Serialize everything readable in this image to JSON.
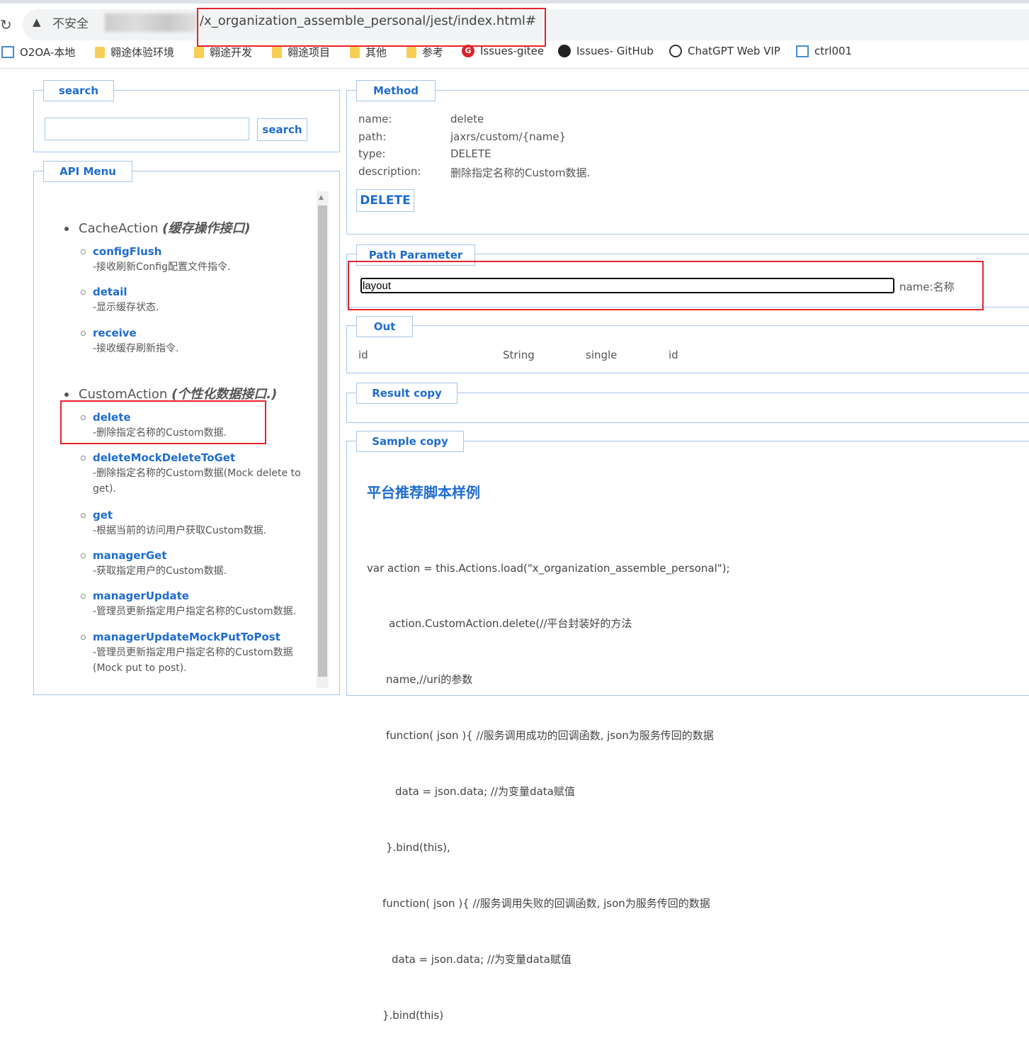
{
  "browser": {
    "security_label": "不安全",
    "url": "/x_organization_assemble_personal/jest/index.html#",
    "bookmarks": [
      {
        "label": "O2OA-本地",
        "icon": "o2oa-icon"
      },
      {
        "label": "翱途体验环境",
        "icon": "folder-icon"
      },
      {
        "label": "翱途开发",
        "icon": "folder-icon"
      },
      {
        "label": "翱途项目",
        "icon": "folder-icon"
      },
      {
        "label": "其他",
        "icon": "folder-icon"
      },
      {
        "label": "参考",
        "icon": "folder-icon"
      },
      {
        "label": "Issues-gitee",
        "icon": "gitee-icon"
      },
      {
        "label": "Issues- GitHub",
        "icon": "github-icon"
      },
      {
        "label": "ChatGPT Web VIP",
        "icon": "openai-icon"
      },
      {
        "label": "ctrl001",
        "icon": "o2oa-icon"
      }
    ]
  },
  "search": {
    "legend": "search",
    "value": "",
    "button": "search"
  },
  "api_menu": {
    "legend": "API Menu",
    "groups": [
      {
        "name": "CacheAction",
        "note": "(缓存操作接口)",
        "items": [
          {
            "name": "configFlush",
            "desc": "-接收刷新Config配置文件指令."
          },
          {
            "name": "detail",
            "desc": "-显示缓存状态."
          },
          {
            "name": "receive",
            "desc": "-接收缓存刷新指令."
          }
        ]
      },
      {
        "name": "CustomAction",
        "note": "(个性化数据接口.)",
        "items": [
          {
            "name": "delete",
            "desc": "-删除指定名称的Custom数据."
          },
          {
            "name": "deleteMockDeleteToGet",
            "desc": "-删除指定名称的Custom数据(Mock delete to get)."
          },
          {
            "name": "get",
            "desc": "-根据当前的访问用户获取Custom数据."
          },
          {
            "name": "managerGet",
            "desc": "-获取指定用户的Custom数据."
          },
          {
            "name": "managerUpdate",
            "desc": "-管理员更新指定用户指定名称的Custom数据."
          },
          {
            "name": "managerUpdateMockPutToPost",
            "desc": "-管理员更新指定用户指定名称的Custom数据(Mock put to post)."
          }
        ]
      }
    ]
  },
  "method": {
    "legend": "Method",
    "labels": {
      "name": "name:",
      "path": "path:",
      "type": "type:",
      "description": "description:"
    },
    "name": "delete",
    "path": "jaxrs/custom/{name}",
    "type": "DELETE",
    "description": "删除指定名称的Custom数据.",
    "button": "DELETE"
  },
  "path_parameter": {
    "legend": "Path Parameter",
    "value": "layout",
    "label": "name:名称"
  },
  "out": {
    "legend": "Out",
    "columns": [
      "id",
      "String",
      "single",
      "id"
    ]
  },
  "result": {
    "legend": "Result copy"
  },
  "sample": {
    "legend": "Sample copy",
    "heading": "平台推荐脚本样例",
    "lines": [
      "var action = this.Actions.load(\"x_organization_assemble_personal\");",
      "action.CustomAction.delete(//平台封装好的方法",
      "name,//uri的参数",
      "function( json ){ //服务调用成功的回调函数, json为服务传回的数据",
      "data = json.data; //为变量data赋值",
      "}.bind(this),",
      "function( json ){ //服务调用失败的回调函数, json为服务传回的数据",
      "data = json.data; //为变量data赋值",
      "}.bind(this)"
    ]
  },
  "colors": {
    "accent": "#1f6ccf",
    "border": "#a7c7ea",
    "annotation": "#e8232b"
  }
}
